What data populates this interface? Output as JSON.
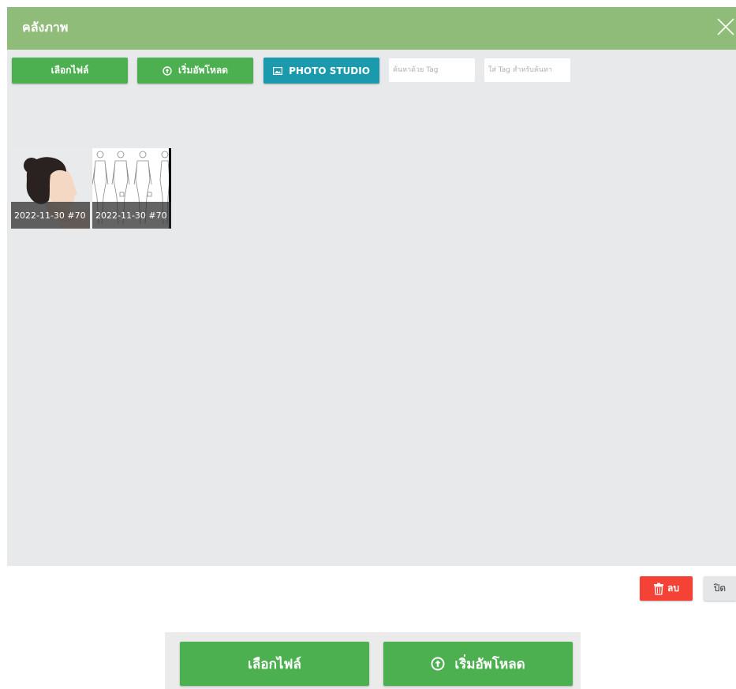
{
  "modal": {
    "title": "คลังภาพ",
    "close_icon": "close-icon"
  },
  "toolbar": {
    "select_file_label": "เลือกไฟล์",
    "start_upload_label": "เริ่มอัพโหลด",
    "photo_studio_label": "PHOTO STUDIO",
    "search_tag_placeholder": "ค้นหาด้วย Tag",
    "assign_tag_placeholder": "ใส่ Tag สำหรับค้นหา"
  },
  "gallery": {
    "items": [
      {
        "caption": "2022-11-30 #70",
        "icon": "portrait-photo"
      },
      {
        "caption": "2022-11-30 #70",
        "icon": "body-diagram"
      }
    ]
  },
  "footer": {
    "delete_label": "ลบ",
    "close_label": "ปิด"
  },
  "page_bottom": {
    "select_file_label": "เลือกไฟล์",
    "start_upload_label": "เริ่มอัพโหลด"
  },
  "colors": {
    "header": "#8fbc78",
    "green_button": "#4caf50",
    "teal_button": "#1a9aac",
    "delete_button": "#f44336",
    "gallery_bg": "#e8e9eb"
  }
}
